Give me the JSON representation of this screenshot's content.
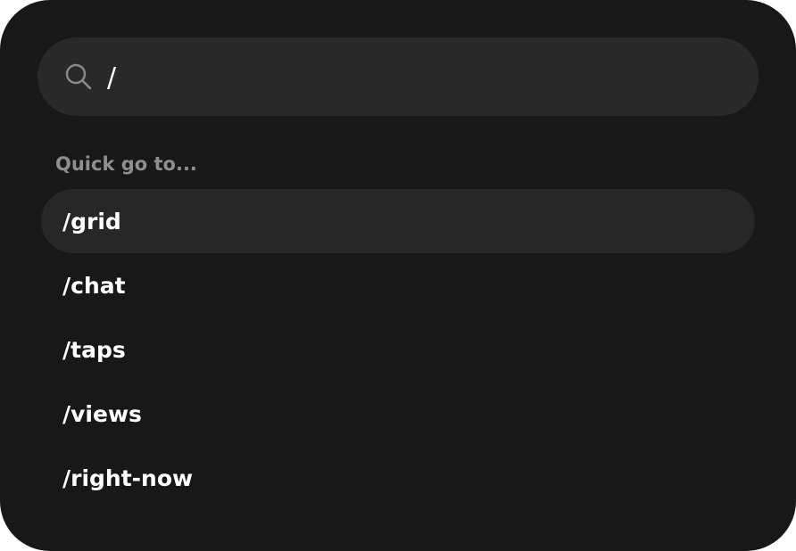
{
  "search": {
    "value": "/",
    "icon": "search-icon"
  },
  "section": {
    "label": "Quick go to..."
  },
  "results": [
    {
      "label": "/grid",
      "selected": true
    },
    {
      "label": "/chat",
      "selected": false
    },
    {
      "label": "/taps",
      "selected": false
    },
    {
      "label": "/views",
      "selected": false
    },
    {
      "label": "/right-now",
      "selected": false
    }
  ],
  "colors": {
    "panel": "#181818",
    "search_bg": "#292929",
    "selected_bg": "#272727",
    "text": "#ffffff",
    "muted": "#8e8e8e"
  }
}
